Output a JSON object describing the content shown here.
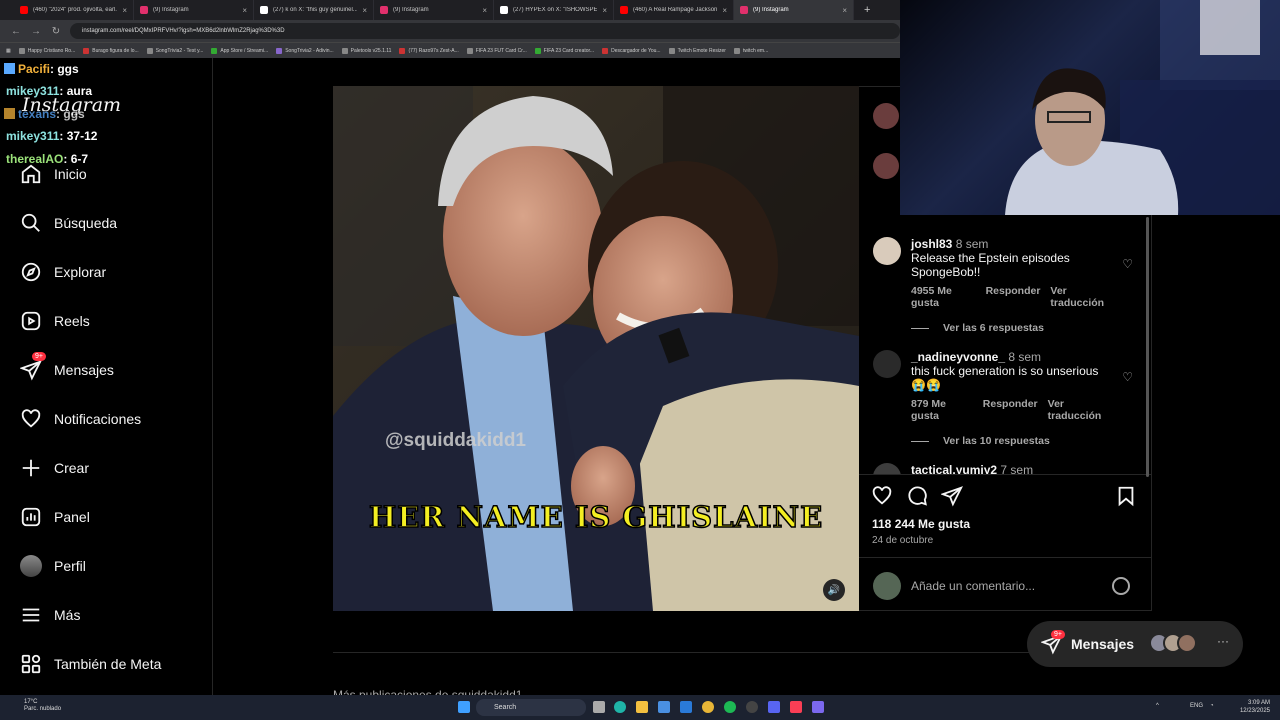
{
  "browser": {
    "tabs": [
      {
        "label": "(460) \"2024\" prod. ojivolta, earl...",
        "color": "#ff0000"
      },
      {
        "label": "(9) Instagram",
        "color": "#e1306c"
      },
      {
        "label": "(27) k on X: \"this guy genuinel...",
        "color": "#ffffff"
      },
      {
        "label": "(9) Instagram",
        "color": "#e1306c"
      },
      {
        "label": "(27) HYPEX on X: \"ISHOWSPEE...",
        "color": "#ffffff"
      },
      {
        "label": "(460) A Real Rampage Jackson...",
        "color": "#ff0000"
      },
      {
        "label": "(9) Instagram",
        "color": "#e1306c"
      }
    ],
    "new_tab": "+",
    "url": "instagram.com/reel/DQMxIPRFVHv/?igsh=MXB6d2lnbWlmZ2Rjag%3D%3D",
    "bookmarks": [
      "Happy Cristiano Ro...",
      "Burago figura de lo...",
      "SongTrivia2 - Test y...",
      "App Store / Streami...",
      "SongTrivia2 - Adivin...",
      "Paletools v25.1.11",
      "(77) Razo97s Zest-A...",
      "FIFA 23 FUT Card Cr...",
      "FIFA 23 Card creator...",
      "Descargador de You...",
      "Twitch Emote Resizer",
      "twitch em..."
    ]
  },
  "sidebar": {
    "logo": "Instagram",
    "items": [
      {
        "label": "Inicio",
        "icon": "home-icon"
      },
      {
        "label": "Búsqueda",
        "icon": "search-icon"
      },
      {
        "label": "Explorar",
        "icon": "compass-icon"
      },
      {
        "label": "Reels",
        "icon": "reels-icon"
      },
      {
        "label": "Mensajes",
        "icon": "messenger-icon",
        "badge": "9+"
      },
      {
        "label": "Notificaciones",
        "icon": "heart-icon"
      },
      {
        "label": "Crear",
        "icon": "plus-icon"
      },
      {
        "label": "Panel",
        "icon": "dashboard-icon"
      },
      {
        "label": "Perfil",
        "icon": "avatar"
      },
      {
        "label": "Más",
        "icon": "menu-icon"
      },
      {
        "label": "También de Meta",
        "icon": "meta-grid-icon"
      }
    ]
  },
  "stream_chat": [
    {
      "user": "Pacifi",
      "msg": ": ggs"
    },
    {
      "user": "mikey311",
      "msg": ": aura"
    },
    {
      "user": "texans",
      "msg": ": ggs"
    },
    {
      "user": "mikey311",
      "msg": ": 37-12"
    },
    {
      "user": "therealAO",
      "msg": ": 6-7"
    }
  ],
  "post": {
    "watermark": "@squiddakidd1",
    "caption": "HER NAME IS GHISLAINE",
    "comments": [
      {
        "user": "joshl83",
        "time": "8 sem",
        "text": "Release the Epstein episodes SpongeBob!!",
        "likes": "4955 Me gusta",
        "reply": "Responder",
        "translate": "Ver traducción",
        "replies": "Ver las 6 respuestas"
      },
      {
        "user": "_nadineyvonne_",
        "time": "8 sem",
        "text": "this fuck generation is so unserious",
        "emoji": "😭😭",
        "likes": "879 Me gusta",
        "reply": "Responder",
        "translate": "Ver traducción",
        "replies": "Ver las 10 respuestas"
      },
      {
        "user": "tactical.yumiy2",
        "time": "7 sem"
      }
    ],
    "like_count": "118 244 Me gusta",
    "date": "24 de octubre",
    "add_comment_placeholder": "Añade un comentario...",
    "more_posts": "Más publicaciones de squiddakidd1"
  },
  "messages_pill": {
    "label": "Mensajes",
    "badge": "9+",
    "more": "···"
  },
  "taskbar": {
    "weather_temp": "17°C",
    "weather_desc": "Parc. nublado",
    "search": "Search",
    "lang": "ENG",
    "time": "3:09 AM",
    "date": "12/23/2025"
  }
}
